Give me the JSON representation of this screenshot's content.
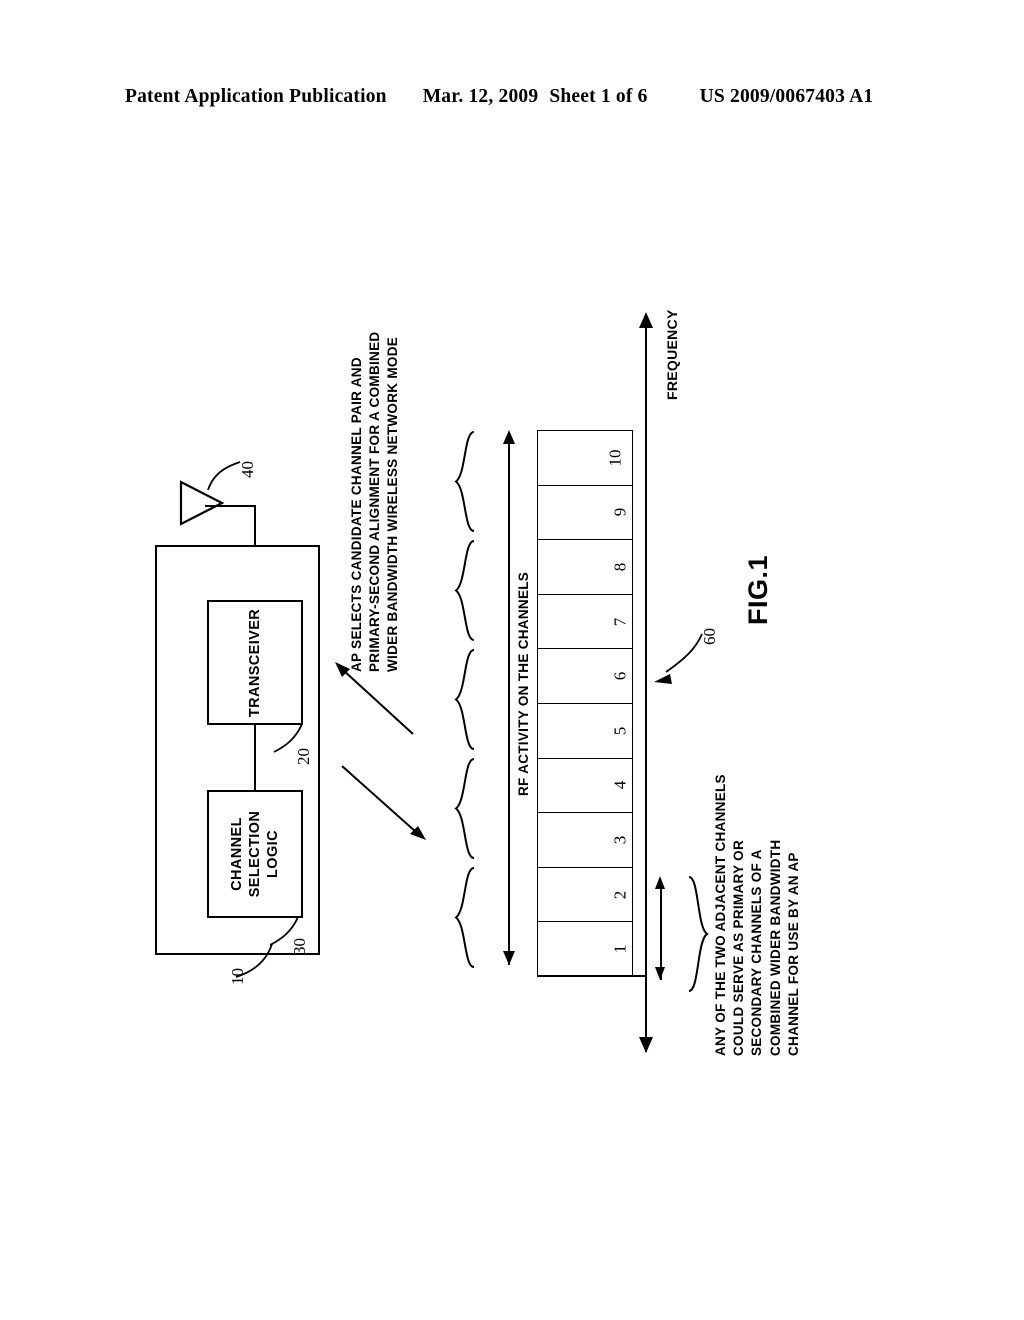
{
  "header": {
    "publication": "Patent Application Publication",
    "date": "Mar. 12, 2009",
    "sheet": "Sheet 1 of 6",
    "patent_number": "US 2009/0067403 A1"
  },
  "figure": {
    "caption": "FIG.1",
    "apparatus": {
      "enclosure_ref": "10",
      "transceiver": {
        "label": "TRANSCEIVER",
        "ref": "20"
      },
      "channel_selection_logic": {
        "line1": "CHANNEL",
        "line2": "SELECTION",
        "line3": "LOGIC",
        "ref": "30"
      },
      "antenna": {
        "ref": "40",
        "icon": "antenna-triangle-icon"
      }
    },
    "ap_callout": {
      "line1": "AP SELECTS CANDIDATE CHANNEL PAIR AND",
      "line2": "PRIMARY-SECOND ALIGNMENT FOR A COMBINED",
      "line3": "WIDER BANDWIDTH WIRELESS NETWORK MODE"
    },
    "channel_grid": {
      "ref": "60",
      "channels": [
        "1",
        "2",
        "3",
        "4",
        "5",
        "6",
        "7",
        "8",
        "9",
        "10"
      ],
      "pair_braces": 5
    },
    "rf_activity_label": "RF ACTIVITY ON THE CHANNELS",
    "frequency_axis_label": "FREQUENCY",
    "adjacent_callout": {
      "line1": "ANY OF THE TWO ADJACENT CHANNELS",
      "line2": "COULD SERVE AS PRIMARY OR",
      "line3": "SECONDARY CHANNELS OF A",
      "line4": "COMBINED WIDER BANDWIDTH",
      "line5": "CHANNEL FOR USE BY AN AP"
    }
  },
  "colors": {
    "ink": "#000000",
    "paper": "#ffffff"
  }
}
